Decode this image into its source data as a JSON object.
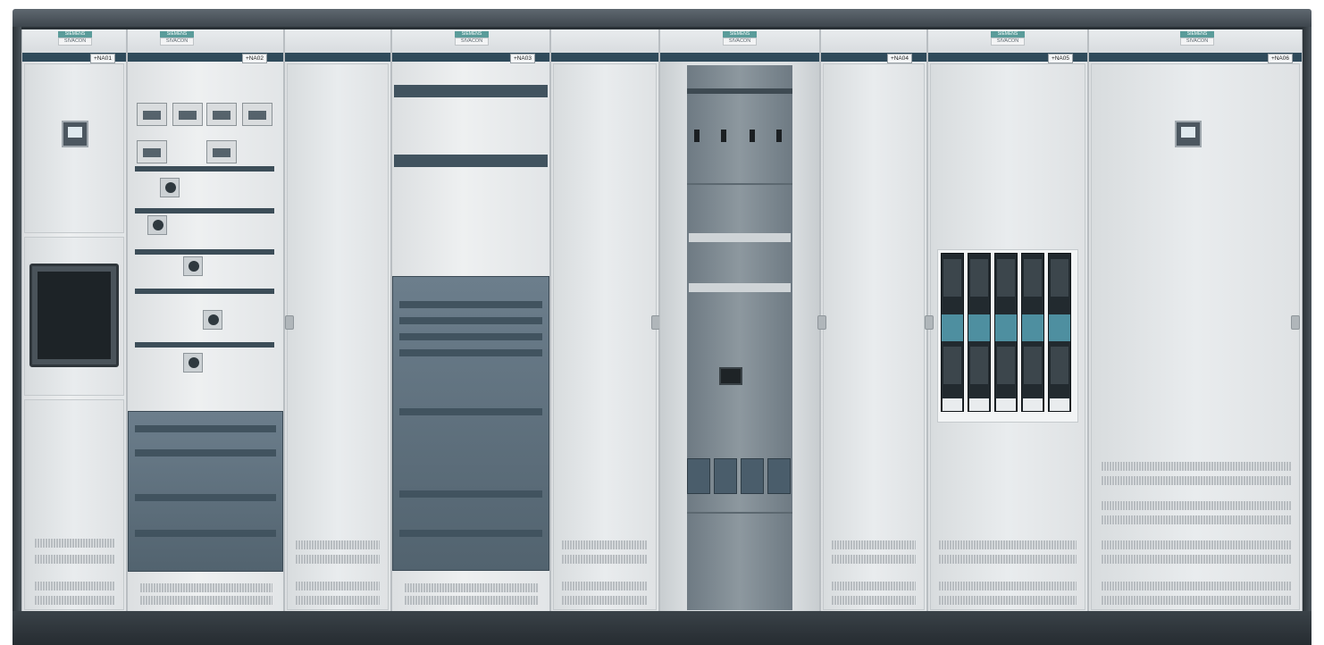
{
  "photo": {
    "subject": "Siemens SIVACON low-voltage switchboard",
    "brand_labels": [
      {
        "top": "SIEMENS",
        "bottom": "SIVACON"
      },
      {
        "top": "SIEMENS",
        "bottom": "SIVACON"
      },
      {
        "top": "SIEMENS",
        "bottom": "SIVACON"
      },
      {
        "top": "SIEMENS",
        "bottom": "SIVACON"
      },
      {
        "top": "SIEMENS",
        "bottom": "SIVACON"
      },
      {
        "top": "SIEMENS",
        "bottom": "SIVACON"
      }
    ],
    "section_tags": [
      "+NA01",
      "+NA02",
      "+NA03",
      "+NA04",
      "+NA05",
      "+NA06"
    ],
    "colors": {
      "cabinet": "#e6e9eb",
      "roof": "#3b434a",
      "plinth": "#262c31",
      "accent_band": "#2f4a5a",
      "module_blue": "#52636f"
    },
    "icons": [
      "power-meter-icon",
      "air-circuit-breaker-icon",
      "rotary-switch-icon",
      "fuse-switch-icon",
      "busbar-icon",
      "cable-duct-icon"
    ]
  }
}
